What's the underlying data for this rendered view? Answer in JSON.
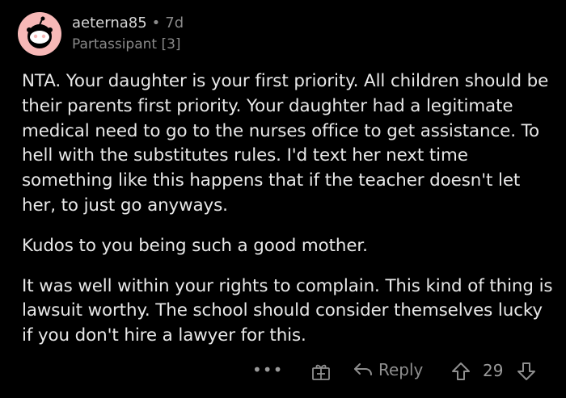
{
  "comment": {
    "username": "aeterna85",
    "separator": "•",
    "age": "7d",
    "flair": "Partassipant [3]",
    "paragraphs": [
      "NTA. Your daughter is your first priority. All children should be their parents first priority. Your daughter had a legitimate medical need to go to the nurses office to get assistance. To hell with the substitutes rules. I'd text her next time something like this happens that if the teacher doesn't let her, to just go anyways.",
      "Kudos to you being such a good mother.",
      "It was well within your rights to complain. This kind of thing is lawsuit worthy. The school should consider themselves lucky if you don't hire a lawyer for this."
    ]
  },
  "actions": {
    "more_label": "•••",
    "reply_label": "Reply",
    "vote_count": "29"
  },
  "icons": {
    "avatar": "snoo-avatar",
    "more": "more-icon",
    "gift": "gift-icon",
    "reply": "reply-arrow-icon",
    "upvote": "upvote-icon",
    "downvote": "downvote-icon"
  },
  "colors": {
    "background": "#000000",
    "text": "#e8e8e8",
    "muted": "#8a8a8a",
    "avatar_bg": "#f7b8b7"
  }
}
